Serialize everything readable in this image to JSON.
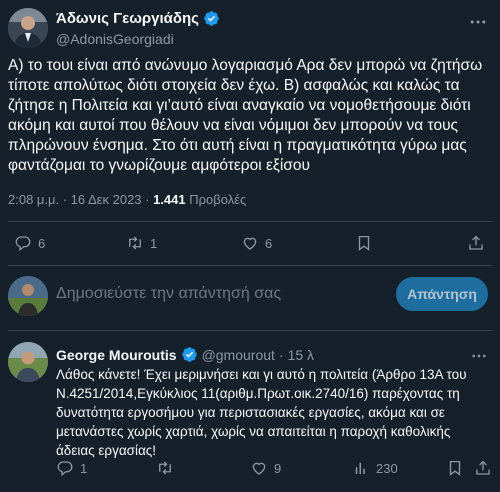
{
  "tweet": {
    "author_name": "Άδωνις Γεωργιάδης",
    "author_handle": "@AdonisGeorgiadi",
    "text": "Α) το τουι είναι από ανώνυμο λογαριασμό Αρα δεν μπορώ να ζητήσω τίποτε απολύτως διότι στοιχεία δεν έχω. Β) ασφαλώς και καλώς τα ζήτησε η Πολιτεία και γι’αυτό είναι αναγκαίο να νομοθετήσουμε διότι ακόμη και αυτοί που θέλουν να είναι νόμιμοι δεν μπορούν να τους πληρώνουν ένσημα. Στο ότι αυτή είναι η πραγματικότητα γύρω μας φαντάζομαι το γνωρίζουμε αμφότεροι εξίσου",
    "timestamp": "2:08 μ.μ. · 16 Δεκ 2023 · ",
    "views_count": "1.441",
    "views_label": " Προβολές",
    "replies": "6",
    "retweets": "1",
    "likes": "6"
  },
  "reply_box": {
    "placeholder": "Δημοσιεύστε την απάντησή σας",
    "button_label": "Απάντηση"
  },
  "reply": {
    "author_name": "George Mouroutis",
    "author_handle": "@gmourout",
    "dot": "·",
    "time": "15 λ",
    "text": "Λάθος κάνετε! Έχει μεριμνήσει και γι αυτό η πολιτεία (Άρθρο 13Α του Ν.4251/2014,Εγκύκλιος 11(αριθμ.Πρωτ.οικ.2740/16) παρέχοντας τη δυνατότητα εργοσήμου για περιστασιακές εργασίες, ακόμα και σε μετανάστες χωρίς χαρτιά, χωρίς να απαιτείται η παροχή καθολικής άδειας εργασίας!",
    "replies": "1",
    "retweets": "",
    "likes": "9",
    "views": "230"
  },
  "icons": {
    "verified": "verified-badge-icon",
    "reply": "reply-icon",
    "retweet": "retweet-icon",
    "like": "heart-icon",
    "bookmark": "bookmark-icon",
    "share": "share-icon",
    "views": "views-icon",
    "more": "more-icon"
  },
  "colors": {
    "background": "#15202b",
    "text": "#f7f9f9",
    "muted": "#8b98a5",
    "accent": "#1d9bf0",
    "button": "#1d6e9f"
  }
}
